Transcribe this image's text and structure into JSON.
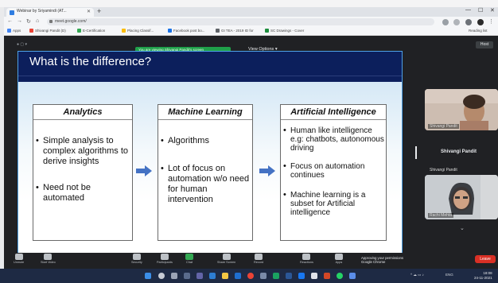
{
  "browser": {
    "tab_title": "Webinar by Sriyamindi (AT...",
    "tab_close": "✕",
    "new_tab": "+",
    "url": "meet.google.com/",
    "window_min": "—",
    "window_max": "☐",
    "window_close": "✕",
    "bookmarks": [
      "Apps",
      "Shivangi Pandit (D)",
      "E-Certification",
      "Placing Classif...",
      "Facebook post bo...",
      "GI TEA - 2019 ID for",
      "SC Drawings - Cover"
    ],
    "bookmarks_right": "Reading list"
  },
  "meet": {
    "sharing_notice": "You are viewing Shivangi Pandit's screen",
    "view_options": "View Options ▾",
    "top_badge": "Host",
    "leave_label": "Leave",
    "toast_line1": "Approving your permissions",
    "toast_line2": "Google Chrome",
    "controls": [
      "Unmute",
      "Start Video",
      "Security",
      "Participants",
      "Chat",
      "Share Screen",
      "Record",
      "Reactions",
      "Apps",
      "Whiteboards"
    ],
    "participants": [
      {
        "name": "Shivangi Pandit",
        "label": "Shivangi Pandit"
      },
      {
        "name": "Rachi Mehta",
        "label": "Rachi Mehta"
      }
    ]
  },
  "slide": {
    "title": "What is the difference?",
    "columns": [
      {
        "heading": "Analytics",
        "bullets": [
          "Simple analysis to complex algorithms to derive insights",
          "Need not be automated"
        ]
      },
      {
        "heading": "Machine Learning",
        "bullets": [
          "Algorithms",
          "Lot of focus on automation w/o need for human intervention"
        ]
      },
      {
        "heading": "Artificial Intelligence",
        "bullets": [
          "Human like intelligence e.g: chatbots, autonomous driving",
          "Focus on automation continues",
          "Machine learning is a subset for Artificial intelligence"
        ]
      }
    ]
  },
  "taskbar": {
    "time": "18:08",
    "date": "24-11-2021",
    "tray_text": "ENG"
  },
  "colors": {
    "slide_header": "#0c1f5c",
    "arrow": "#4472c4",
    "leave": "#d93025",
    "share_bar": "#1fa04a"
  }
}
